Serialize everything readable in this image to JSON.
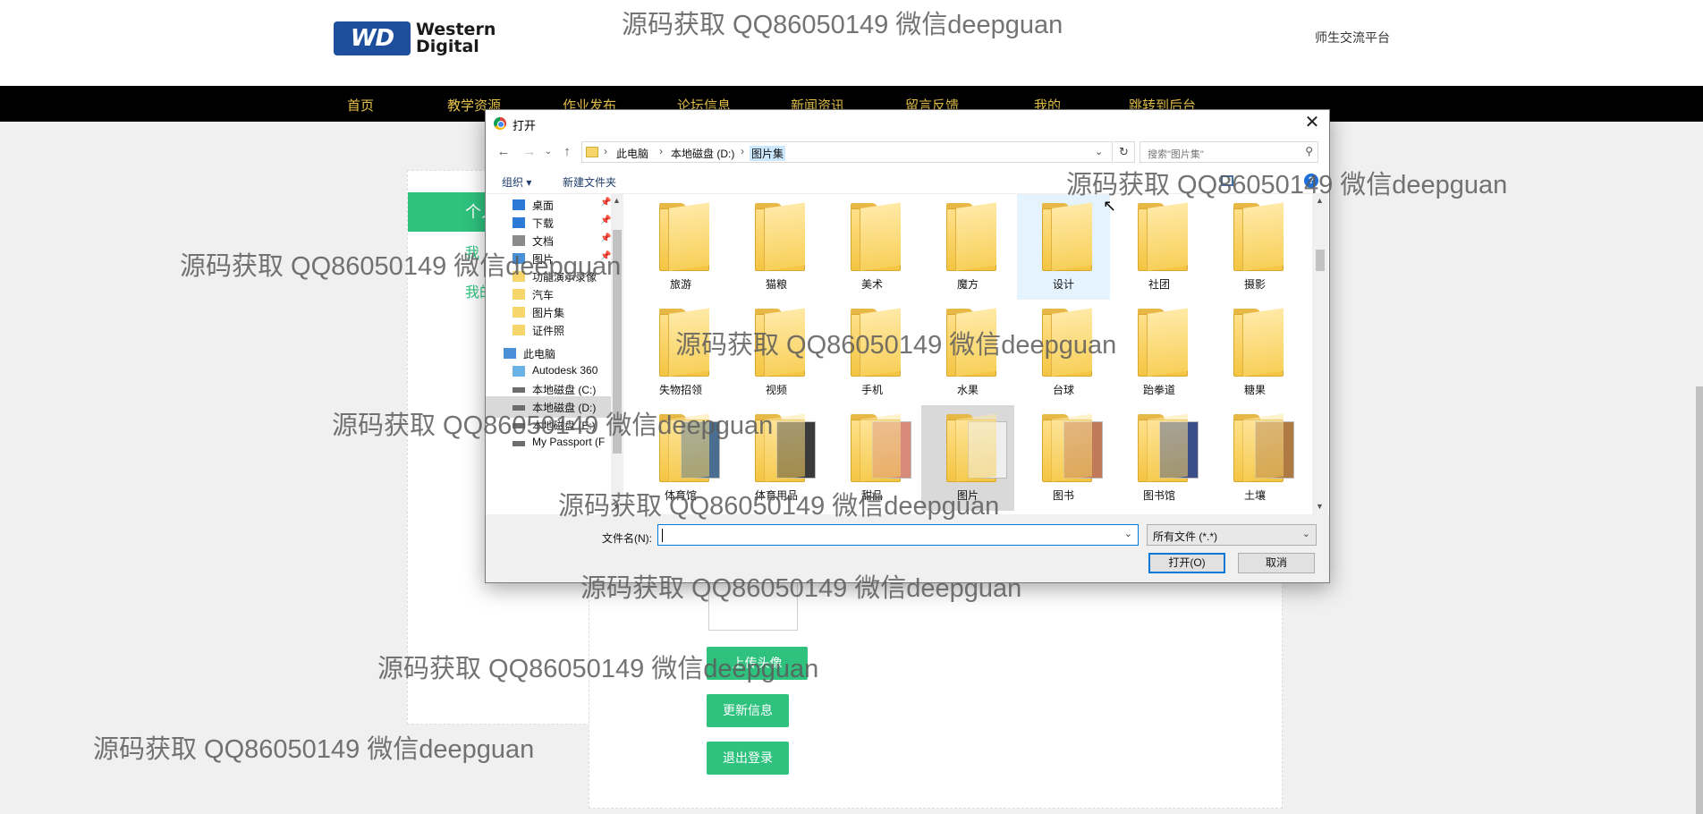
{
  "site": {
    "logo_mark": "WD",
    "logo_line1": "Western",
    "logo_line2": "Digital",
    "slogan": "师生交流平台"
  },
  "nav": [
    "首页",
    "教学资源",
    "作业发布",
    "论坛信息",
    "新闻资讯",
    "留言反馈",
    "我的",
    "跳转到后台"
  ],
  "left_panel": {
    "title": "个人",
    "links": [
      "我",
      "我的"
    ]
  },
  "main_panel": {
    "buttons": [
      "上传头像",
      "更新信息",
      "退出登录"
    ]
  },
  "dialog": {
    "title": "打开",
    "close": "✕",
    "breadcrumb": [
      "此电脑",
      "本地磁盘 (D:)",
      "图片集"
    ],
    "search_placeholder": "搜索\"图片集\"",
    "commands": {
      "organize": "组织 ▾",
      "new_folder": "新建文件夹"
    },
    "help": "?",
    "tree": [
      {
        "label": "桌面",
        "icon": "desktop-icon",
        "pinned": true
      },
      {
        "label": "下载",
        "icon": "download-icon",
        "pinned": true
      },
      {
        "label": "文档",
        "icon": "document-icon",
        "pinned": true
      },
      {
        "label": "图片",
        "icon": "picture-icon",
        "pinned": true
      },
      {
        "label": "功能演示录像",
        "icon": "folder-icon",
        "pinned": false
      },
      {
        "label": "汽车",
        "icon": "folder-icon",
        "pinned": false
      },
      {
        "label": "图片集",
        "icon": "folder-icon",
        "pinned": false
      },
      {
        "label": "证件照",
        "icon": "folder-icon",
        "pinned": false
      },
      {
        "label": "此电脑",
        "icon": "computer-icon",
        "pinned": false
      },
      {
        "label": "Autodesk 360",
        "icon": "cloud-icon",
        "pinned": false
      },
      {
        "label": "本地磁盘 (C:)",
        "icon": "drive-icon",
        "pinned": false
      },
      {
        "label": "本地磁盘 (D:)",
        "icon": "drive-icon",
        "pinned": false
      },
      {
        "label": "本地磁盘 (E:)",
        "icon": "drive-icon",
        "pinned": false
      },
      {
        "label": "My Passport (F",
        "icon": "drive-icon",
        "pinned": false
      }
    ],
    "folders": [
      {
        "label": "旅游",
        "thumb": null
      },
      {
        "label": "猫粮",
        "thumb": null
      },
      {
        "label": "美术",
        "thumb": null
      },
      {
        "label": "魔方",
        "thumb": null
      },
      {
        "label": "设计",
        "thumb": null
      },
      {
        "label": "社团",
        "thumb": null
      },
      {
        "label": "摄影",
        "thumb": null
      },
      {
        "label": "失物招领",
        "thumb": null
      },
      {
        "label": "视频",
        "thumb": null
      },
      {
        "label": "手机",
        "thumb": null
      },
      {
        "label": "水果",
        "thumb": null
      },
      {
        "label": "台球",
        "thumb": null
      },
      {
        "label": "跆拳道",
        "thumb": null
      },
      {
        "label": "糖果",
        "thumb": null
      },
      {
        "label": "体育馆",
        "thumb": "#4a6e8f"
      },
      {
        "label": "体育用品",
        "thumb": "#3a3a3a"
      },
      {
        "label": "甜品",
        "thumb": "#d88a7a"
      },
      {
        "label": "图片",
        "thumb": "#eeeeee"
      },
      {
        "label": "图书",
        "thumb": "#c07a5a"
      },
      {
        "label": "图书馆",
        "thumb": "#3b4e8a"
      },
      {
        "label": "土壤",
        "thumb": "#b07a45"
      }
    ],
    "filename_label": "文件名(N):",
    "filename_value": "",
    "filetype": "所有文件 (*.*)",
    "open_button": "打开(O)",
    "cancel_button": "取消"
  },
  "watermark": "源码获取 QQ86050149 微信deepguan",
  "colors": {
    "accent_green": "#2ec27e",
    "nav_bg": "#000000",
    "nav_text": "#e8c44a",
    "selection_blue": "#cce8ff",
    "focus_blue": "#0078d7"
  }
}
